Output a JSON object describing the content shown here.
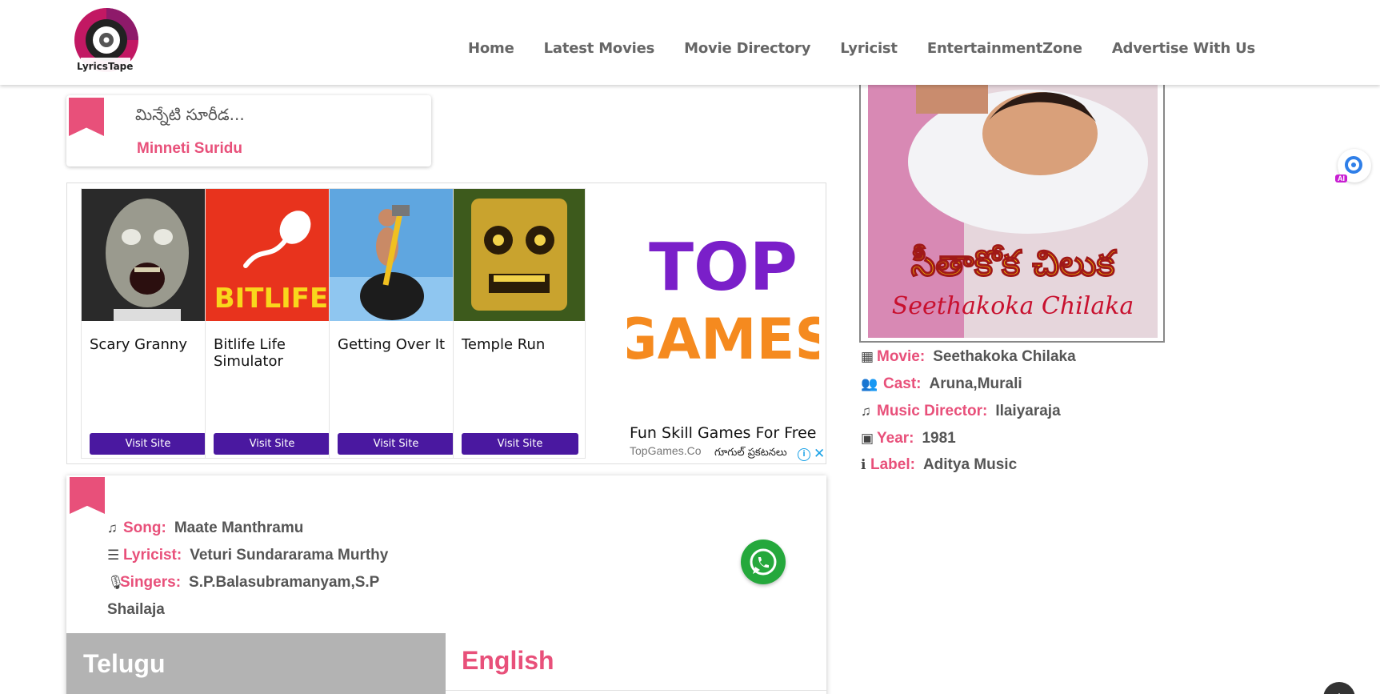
{
  "header": {
    "logo_text": "LyricsTape",
    "nav": [
      "Home",
      "Latest Movies",
      "Movie Directory",
      "Lyricist",
      "EntertainmentZone",
      "Advertise With Us"
    ]
  },
  "title_card": {
    "telugu": "మిన్నేటి సూరీడ...",
    "english": "Minneti Suridu"
  },
  "ad": {
    "games": [
      {
        "name": "Scary Granny",
        "cta": "Visit Site"
      },
      {
        "name": "Bitlife Life Simulator",
        "cta": "Visit Site"
      },
      {
        "name": "Getting Over It",
        "cta": "Visit Site"
      },
      {
        "name": "Temple Run",
        "cta": "Visit Site"
      }
    ],
    "logo_line1": "TOP",
    "logo_line2": "GAMES",
    "bitlife_logo": "BITLIFE",
    "headline": "Fun Skill Games For Free",
    "url": "TopGames.Co",
    "tag": "గూగుల్ ప్రకటనలు",
    "info_glyph": "i",
    "close_glyph": "✕"
  },
  "song": {
    "song_label": "Song:",
    "song_value": "Maate Manthramu",
    "lyricist_label": "Lyricist:",
    "lyricist_value": "Veturi Sundararama Murthy",
    "singers_label": "Singers:",
    "singers_value_line1": "S.P.Balasubramanyam,S.P",
    "singers_value_line2": "Shailaja",
    "tabs": {
      "telugu": "Telugu",
      "english": "English"
    }
  },
  "movie": {
    "poster_title_telugu": "సీతాకోక చిలుక",
    "poster_title_english": "Seethakoka Chilaka",
    "movie_label": "Movie:",
    "movie_value": "Seethakoka Chilaka",
    "cast_label": "Cast:",
    "cast_value": "Aruna,Murali",
    "music_label": "Music Director:",
    "music_value": "Ilaiyaraja",
    "year_label": "Year:",
    "year_value": "1981",
    "label_label": "Label:",
    "label_value": "Aditya Music"
  },
  "floating": {
    "ai_badge": "AI"
  },
  "colors": {
    "accent": "#e8507a",
    "ad_button": "#4a18a0",
    "whatsapp": "#25a83c",
    "tab_inactive": "#b3b3b3"
  },
  "icons": [
    "film-icon",
    "users-icon",
    "music-icon",
    "calendar-icon",
    "info-icon",
    "list-icon",
    "microphone-icon",
    "whatsapp-icon",
    "scroll-top-icon",
    "ai-assistant-icon"
  ]
}
